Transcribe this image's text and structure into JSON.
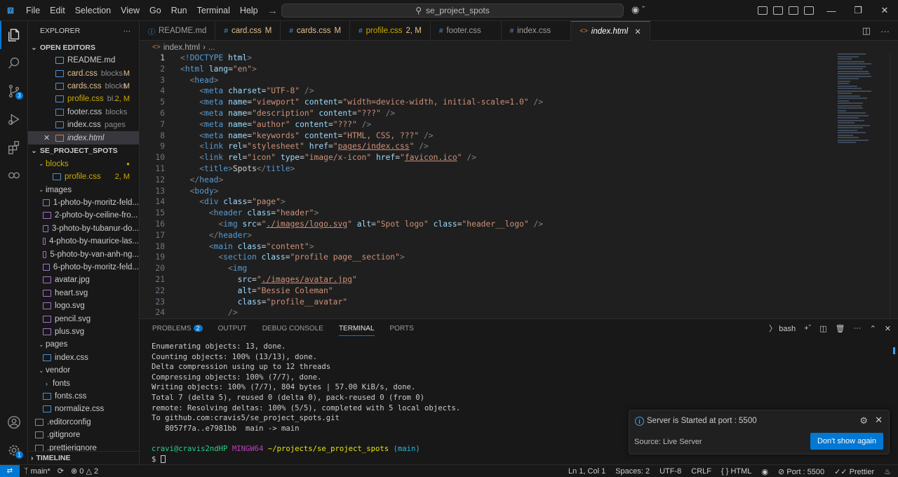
{
  "titlebar": {
    "menu": [
      "File",
      "Edit",
      "Selection",
      "View",
      "Go",
      "Run",
      "Terminal",
      "Help"
    ],
    "search": "se_project_spots"
  },
  "activity": {
    "scm_badge": "3",
    "settings_badge": "1"
  },
  "explorer": {
    "title": "EXPLORER",
    "open_editors_title": "OPEN EDITORS",
    "open_editors": [
      {
        "name": "README.md",
        "sub": "",
        "status": ""
      },
      {
        "name": "card.css",
        "sub": "blocks",
        "status": "M"
      },
      {
        "name": "cards.css",
        "sub": "blocks",
        "status": "M"
      },
      {
        "name": "profile.css",
        "sub": "bl...",
        "status": "2, M"
      },
      {
        "name": "footer.css",
        "sub": "blocks",
        "status": ""
      },
      {
        "name": "index.css",
        "sub": "pages",
        "status": ""
      },
      {
        "name": "index.html",
        "sub": "",
        "status": ""
      }
    ],
    "project_title": "SE_PROJECT_SPOTS",
    "tree": [
      {
        "name": "blocks",
        "type": "folder"
      },
      {
        "name": "profile.css",
        "type": "file",
        "status": "2, M"
      },
      {
        "name": "images",
        "type": "folder"
      },
      {
        "name": "1-photo-by-moritz-feld...",
        "type": "img"
      },
      {
        "name": "2-photo-by-ceiline-fro...",
        "type": "img"
      },
      {
        "name": "3-photo-by-tubanur-do...",
        "type": "img"
      },
      {
        "name": "4-photo-by-maurice-las...",
        "type": "img"
      },
      {
        "name": "5-photo-by-van-anh-ng...",
        "type": "img"
      },
      {
        "name": "6-photo-by-moritz-feld...",
        "type": "img"
      },
      {
        "name": "avatar.jpg",
        "type": "img"
      },
      {
        "name": "heart.svg",
        "type": "img"
      },
      {
        "name": "logo.svg",
        "type": "img"
      },
      {
        "name": "pencil.svg",
        "type": "img"
      },
      {
        "name": "plus.svg",
        "type": "img"
      },
      {
        "name": "pages",
        "type": "folder"
      },
      {
        "name": "index.css",
        "type": "file"
      },
      {
        "name": "vendor",
        "type": "folder"
      },
      {
        "name": "fonts",
        "type": "subfolder"
      },
      {
        "name": "fonts.css",
        "type": "file"
      },
      {
        "name": "normalize.css",
        "type": "file"
      },
      {
        "name": ".editorconfig",
        "type": "cfg"
      },
      {
        "name": ".gitignore",
        "type": "cfg"
      },
      {
        "name": ".prettierignore",
        "type": "cfg"
      }
    ],
    "timeline": "TIMELINE"
  },
  "tabs": [
    {
      "name": "README.md",
      "badge": ""
    },
    {
      "name": "card.css",
      "badge": "M"
    },
    {
      "name": "cards.css",
      "badge": "M"
    },
    {
      "name": "profile.css",
      "badge": "2, M"
    },
    {
      "name": "footer.css",
      "badge": ""
    },
    {
      "name": "index.css",
      "badge": ""
    },
    {
      "name": "index.html",
      "badge": ""
    }
  ],
  "breadcrumb": {
    "file": "index.html",
    "rest": "..."
  },
  "panel": {
    "tabs": [
      "PROBLEMS",
      "OUTPUT",
      "DEBUG CONSOLE",
      "TERMINAL",
      "PORTS"
    ],
    "problems_count": "2",
    "shell": "bash",
    "terminal_lines": [
      "Enumerating objects: 13, done.",
      "Counting objects: 100% (13/13), done.",
      "Delta compression using up to 12 threads",
      "Compressing objects: 100% (7/7), done.",
      "Writing objects: 100% (7/7), 804 bytes | 57.00 KiB/s, done.",
      "Total 7 (delta 5), reused 0 (delta 0), pack-reused 0 (from 0)",
      "remote: Resolving deltas: 100% (5/5), completed with 5 local objects.",
      "To github.com:cravis5/se_project_spots.git",
      "   8057f7a..e7981bb  main -> main"
    ],
    "prompt": {
      "user": "cravi@cravis2ndHP",
      "host": "MINGW64",
      "path": "~/projects/se_project_spots",
      "branch": "(main)"
    },
    "cursor_line": "$"
  },
  "notification": {
    "message": "Server is Started at port : 5500",
    "source": "Source: Live Server",
    "button": "Don't show again"
  },
  "statusbar": {
    "branch": "main*",
    "errors": "0",
    "warnings": "2",
    "position": "Ln 1, Col 1",
    "spaces": "Spaces: 2",
    "encoding": "UTF-8",
    "eol": "CRLF",
    "language": "HTML",
    "port": "Port : 5500",
    "formatter": "Prettier"
  }
}
